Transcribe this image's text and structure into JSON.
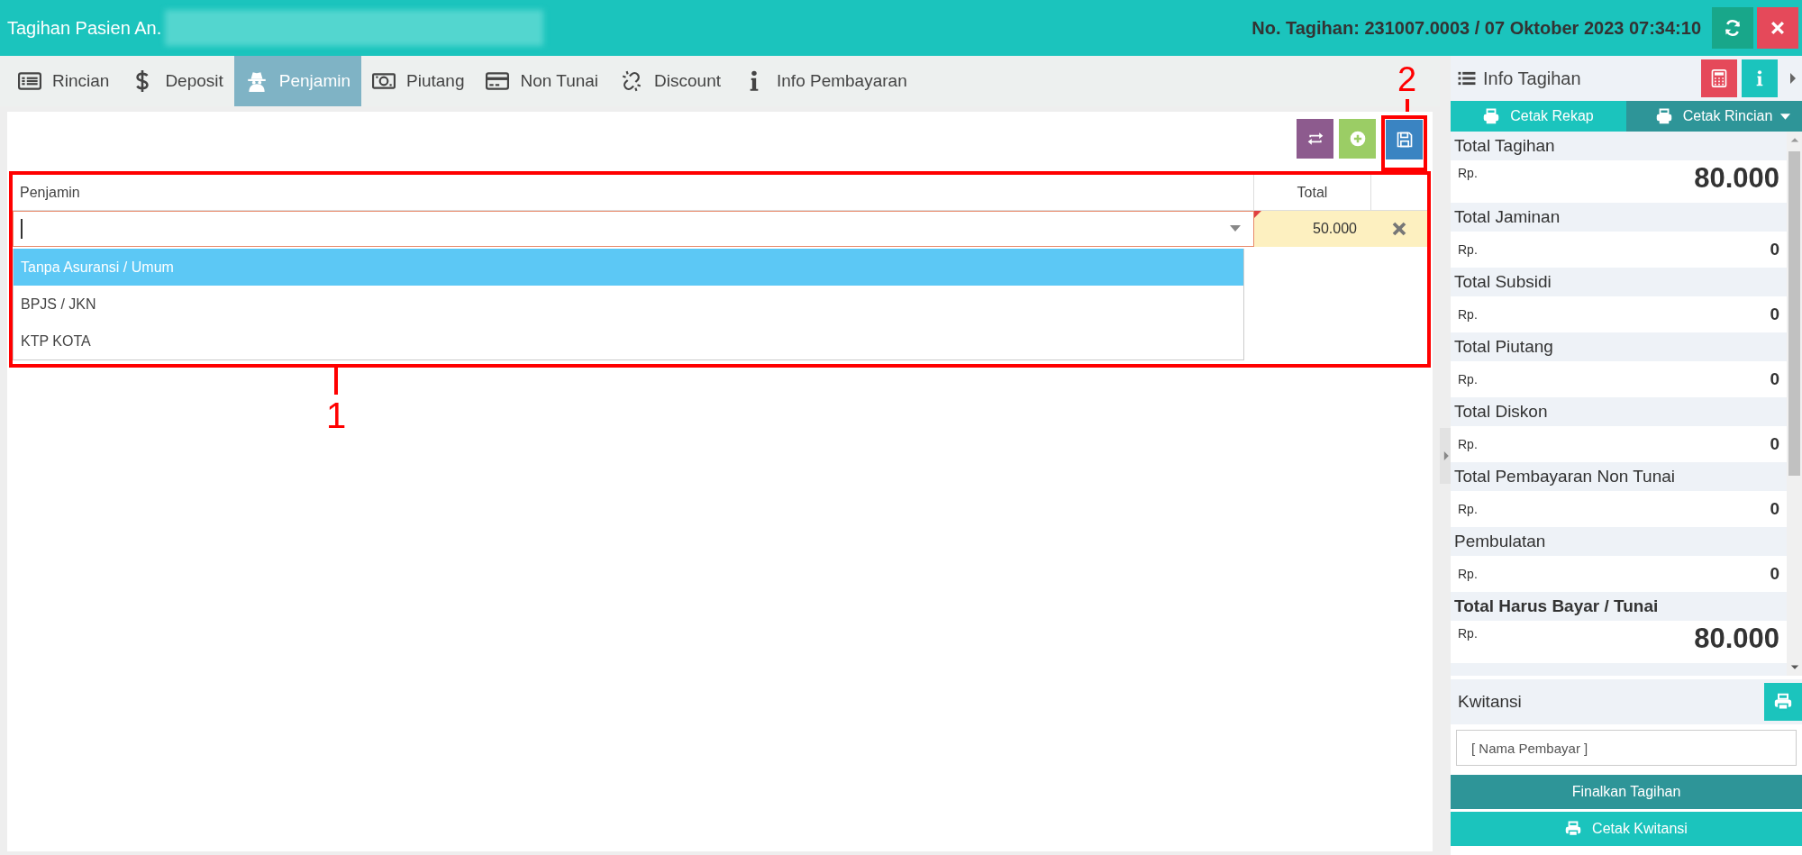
{
  "header": {
    "title": "Tagihan Pasien An.",
    "reference": "No. Tagihan: 231007.0003 / 07 Oktober 2023 07:34:10",
    "buttons": [
      {
        "kind": "refresh"
      },
      {
        "kind": "close"
      }
    ]
  },
  "tabs": [
    {
      "label": "Rincian",
      "kind": "list",
      "selected": false
    },
    {
      "label": "Deposit",
      "kind": "dollar",
      "selected": false
    },
    {
      "label": "Penjamin",
      "kind": "spy",
      "selected": true
    },
    {
      "label": "Piutang",
      "kind": "money",
      "selected": false
    },
    {
      "label": "Non Tunai",
      "kind": "card",
      "selected": false
    },
    {
      "label": "Discount",
      "kind": "unlink",
      "selected": false
    },
    {
      "label": "Info Pembayaran",
      "kind": "info",
      "selected": false
    }
  ],
  "toolbar": [
    {
      "kind": "swap"
    },
    {
      "kind": "add"
    },
    {
      "kind": "save"
    }
  ],
  "table": {
    "columns": [
      "Penjamin",
      "Total"
    ],
    "row": {
      "total": "50.000"
    },
    "dropdown": [
      {
        "label": "Tanpa Asuransi / Umum",
        "selected": true
      },
      {
        "label": "BPJS / JKN",
        "selected": false
      },
      {
        "label": "KTP KOTA",
        "selected": false
      }
    ]
  },
  "annotations": [
    {
      "number": "1"
    },
    {
      "number": "2"
    }
  ],
  "info_panel": {
    "title": "Info Tagihan",
    "buttons": [
      {
        "kind": "calculator"
      },
      {
        "kind": "info"
      }
    ],
    "print_buttons": [
      {
        "label": "Cetak Rekap",
        "dropdown": false
      },
      {
        "label": "Cetak Rincian",
        "dropdown": true
      }
    ],
    "items": [
      {
        "label": "Total Tagihan",
        "currency": "Rp.",
        "value": "80.000",
        "kind": "large",
        "bold_label": false
      },
      {
        "label": "Total Jaminan",
        "currency": "Rp.",
        "value": "0",
        "kind": "normal",
        "bold_label": false
      },
      {
        "label": "Total Subsidi",
        "currency": "Rp.",
        "value": "0",
        "kind": "normal",
        "bold_label": false
      },
      {
        "label": "Total Piutang",
        "currency": "Rp.",
        "value": "0",
        "kind": "normal",
        "bold_label": false
      },
      {
        "label": "Total Diskon",
        "currency": "Rp.",
        "value": "0",
        "kind": "normal",
        "bold_label": false
      },
      {
        "label": "Total Pembayaran Non Tunai",
        "currency": "Rp.",
        "value": "0",
        "kind": "normal",
        "bold_label": false
      },
      {
        "label": "Pembulatan",
        "currency": "Rp.",
        "value": "0",
        "kind": "normal",
        "bold_label": false
      },
      {
        "label": "Total Harus Bayar / Tunai",
        "currency": "Rp.",
        "value": "80.000",
        "kind": "large",
        "bold_label": true
      }
    ]
  },
  "kwitansi": {
    "title": "Kwitansi",
    "placeholder": "[ Nama Pembayar ]",
    "finalize_button": "Finalkan Tagihan",
    "print_button": "Cetak Kwitansi"
  }
}
